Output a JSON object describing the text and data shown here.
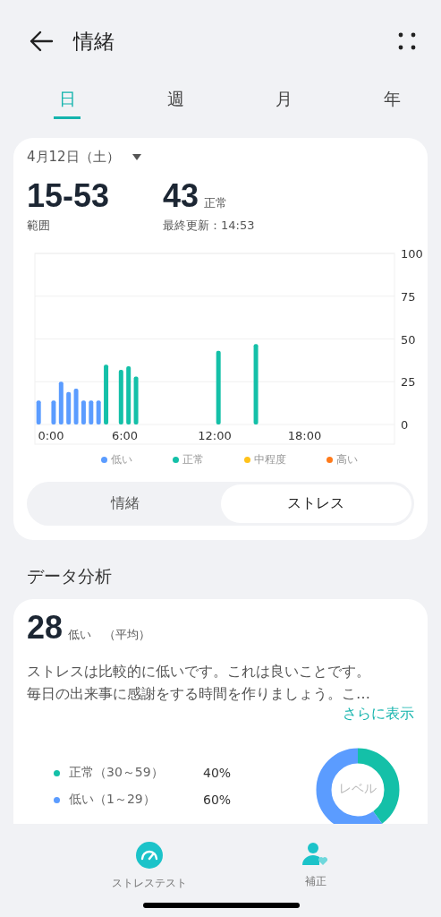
{
  "header": {
    "title": "情緒"
  },
  "tabs": [
    {
      "label": "日",
      "selected": true
    },
    {
      "label": "週",
      "selected": false
    },
    {
      "label": "月",
      "selected": false
    },
    {
      "label": "年",
      "selected": false
    }
  ],
  "summary": {
    "date": "4月12日（土）",
    "range_value": "15-53",
    "range_label": "範囲",
    "current_value": "43",
    "current_status": "正常",
    "last_updated": "最終更新：14:53",
    "chart_data": {
      "type": "bar",
      "x": [
        0,
        1,
        1.5,
        2,
        2.5,
        3,
        3.5,
        4,
        4.5,
        5.5,
        6,
        6.5,
        12,
        14.5
      ],
      "xlim": [
        0,
        24
      ],
      "ylim": [
        0,
        100
      ],
      "xticks": [
        {
          "value": 0,
          "label": "0:00"
        },
        {
          "value": 6,
          "label": "6:00"
        },
        {
          "value": 12,
          "label": "12:00"
        },
        {
          "value": 18,
          "label": "18:00"
        }
      ],
      "yticks": [
        0,
        25,
        50,
        75,
        100
      ],
      "grid": true,
      "series": [
        {
          "name": "低い",
          "color": "#5b9cff",
          "values": [
            14,
            14,
            25,
            19,
            21,
            14,
            14,
            14,
            null,
            null,
            null,
            null,
            null,
            null
          ]
        },
        {
          "name": "正常",
          "color": "#14c0a8",
          "values": [
            null,
            null,
            null,
            null,
            null,
            null,
            null,
            null,
            35,
            32,
            34,
            28,
            43,
            47
          ]
        },
        {
          "name": "中程度",
          "color": "#ffc21a",
          "values": [
            null,
            null,
            null,
            null,
            null,
            null,
            null,
            null,
            null,
            null,
            null,
            null,
            null,
            null
          ]
        },
        {
          "name": "高い",
          "color": "#ff7a1a",
          "values": [
            null,
            null,
            null,
            null,
            null,
            null,
            null,
            null,
            null,
            null,
            null,
            null,
            null,
            null
          ]
        }
      ]
    },
    "segments": [
      {
        "label": "情緒",
        "selected": false
      },
      {
        "label": "ストレス",
        "selected": true
      }
    ]
  },
  "analysis": {
    "heading": "データ分析",
    "average_value": "28",
    "average_status": "低い",
    "average_label": "（平均）",
    "description_lines": [
      "ストレスは比較的に低いです。これは良いことです。",
      "毎日の出来事に感謝をする時間を作りましょう。こ…"
    ],
    "more_link": "さらに表示",
    "distribution": [
      {
        "label": "正常（30～59）",
        "percent": "40%",
        "color": "#14c0a8"
      },
      {
        "label": "低い（1～29）",
        "percent": "60%",
        "color": "#5b9cff"
      }
    ],
    "donut_label": "レベル"
  },
  "bottom_nav": [
    {
      "label": "ストレステスト",
      "kind": "gauge"
    },
    {
      "label": "補正",
      "kind": "person"
    }
  ]
}
